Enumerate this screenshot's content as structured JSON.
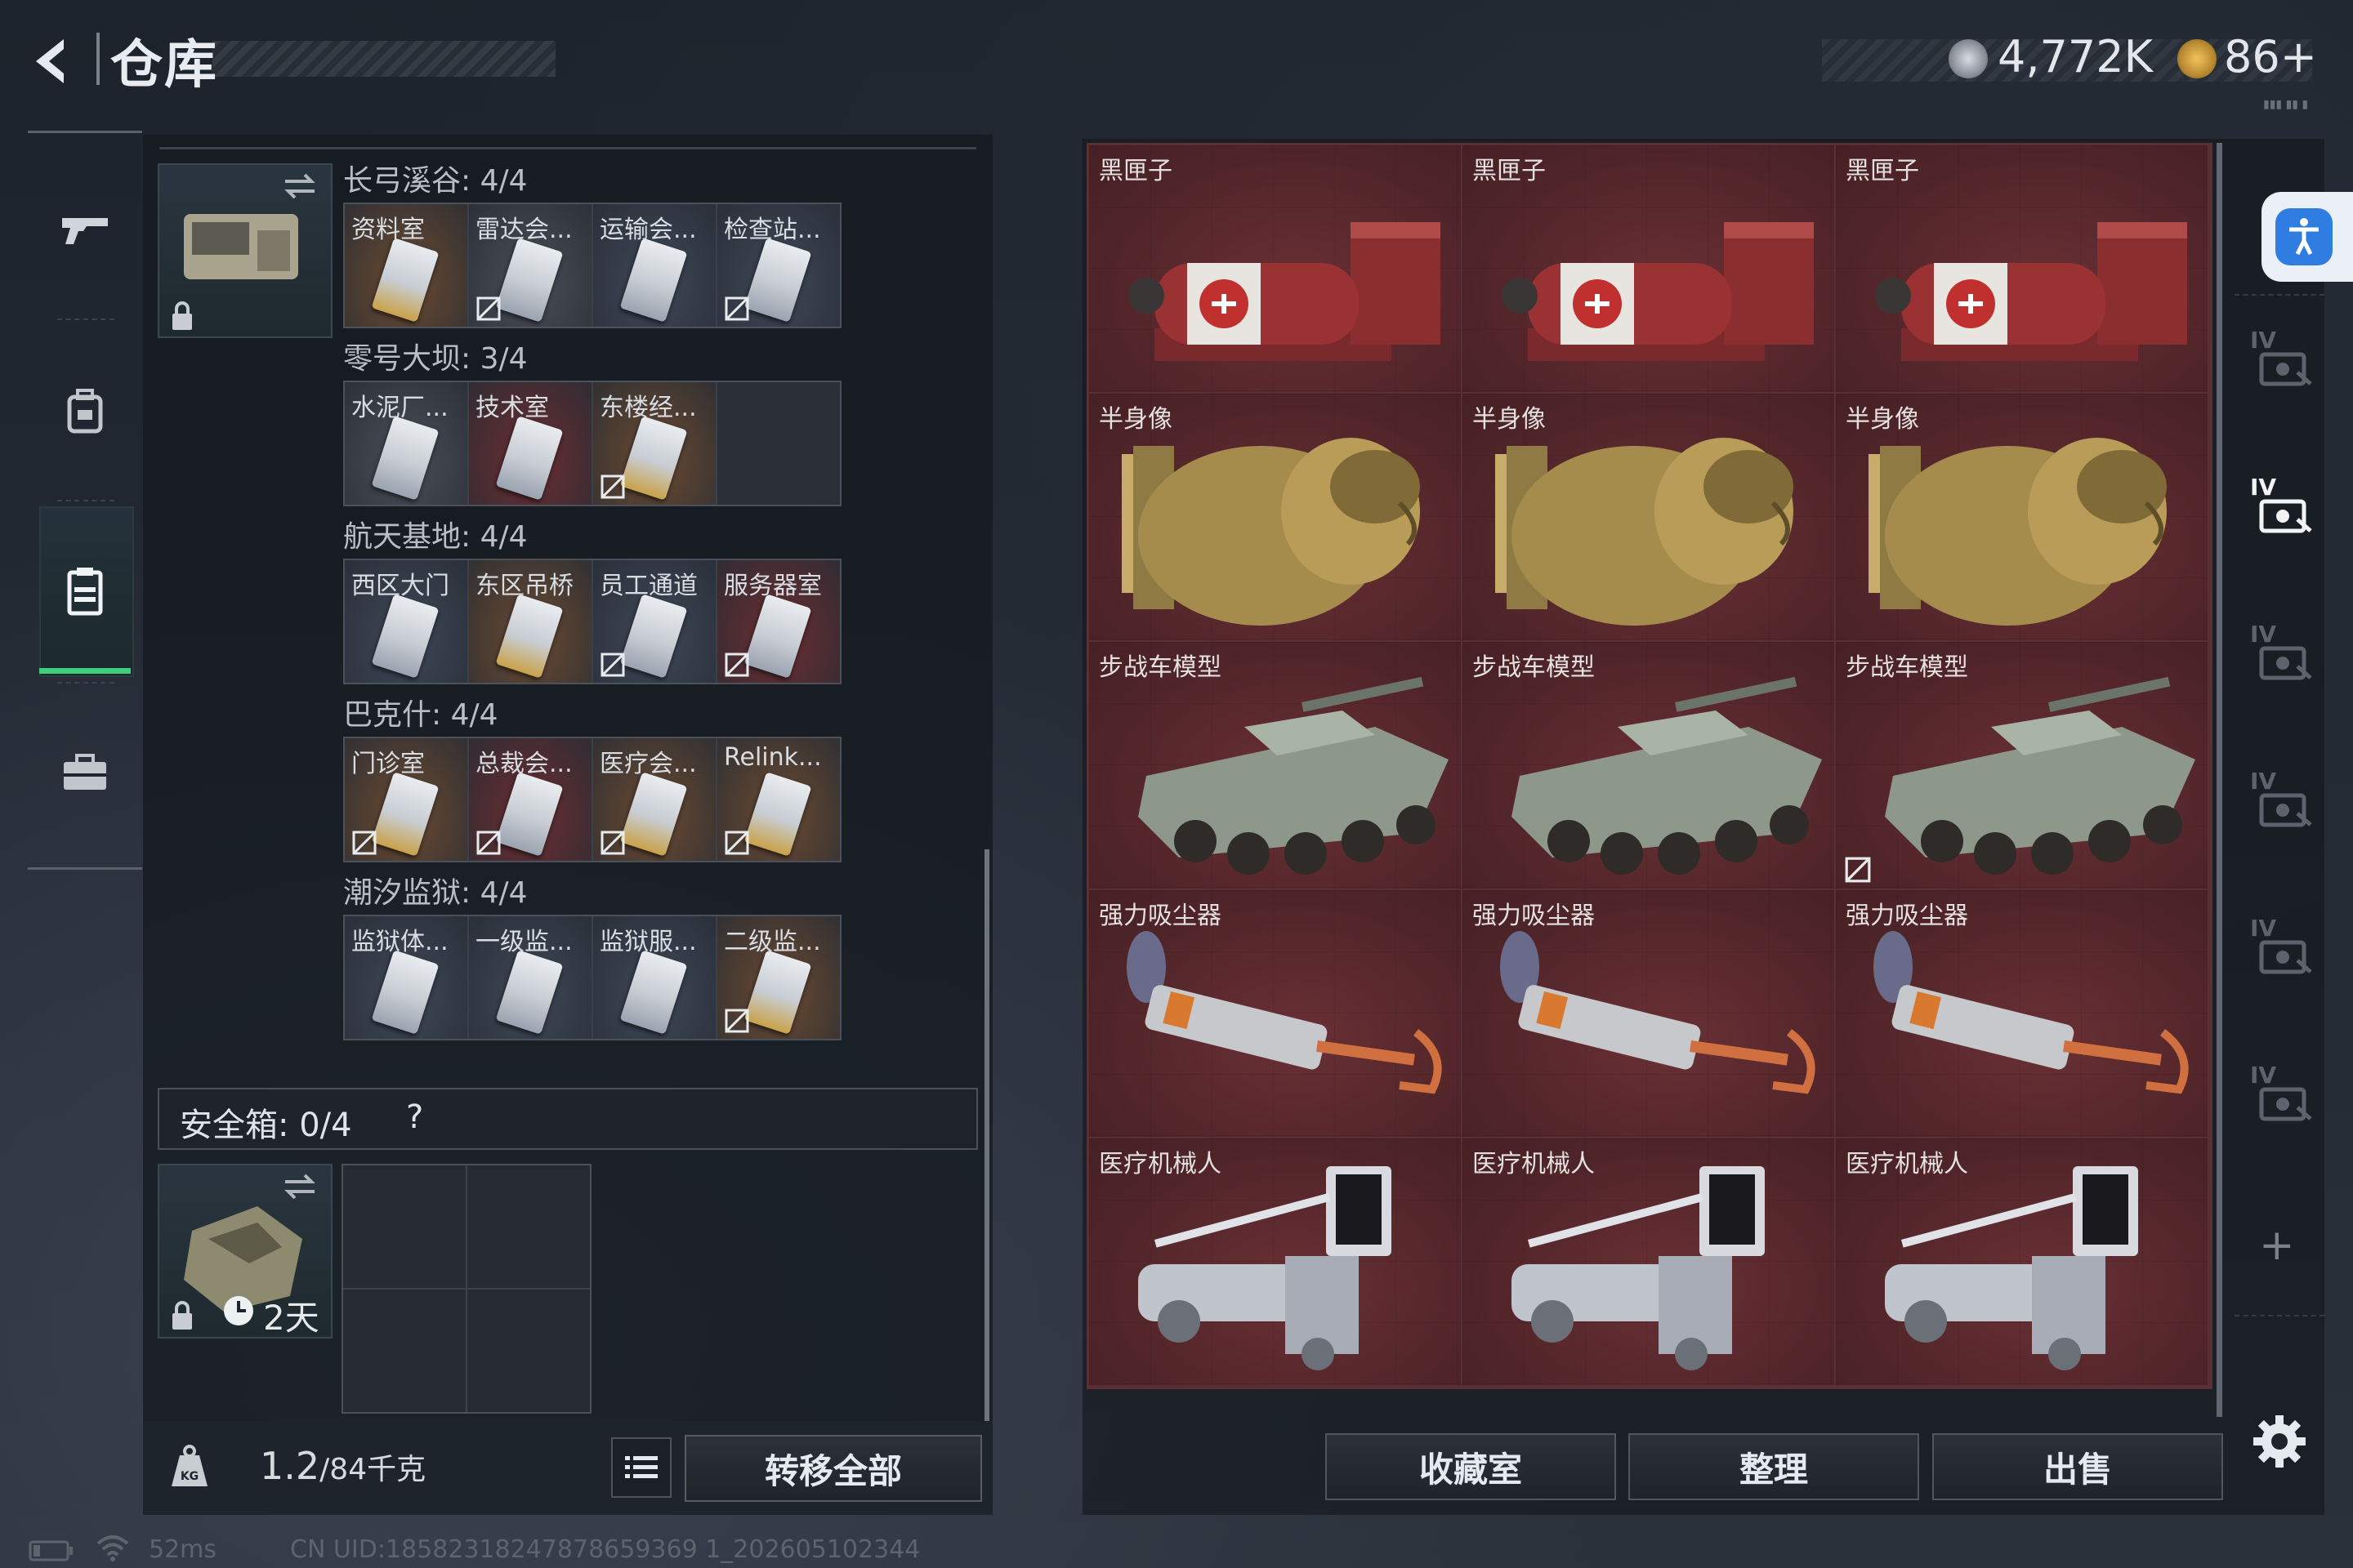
{
  "header": {
    "title": "仓库",
    "currency_coin": "4,772K",
    "currency_tri": "86+",
    "tiny_label": "▮▮▮ ▮▮ ▮"
  },
  "left": {
    "groups": [
      {
        "title": "长弓溪谷: 4/4",
        "cards": [
          {
            "label": "资料室",
            "color": "#6a4a32",
            "flag": false
          },
          {
            "label": "雷达会...",
            "color": "#4a4e58",
            "flag": true
          },
          {
            "label": "运输会...",
            "color": "#3e4858",
            "flag": false
          },
          {
            "label": "检查站...",
            "color": "#3e4858",
            "flag": true
          }
        ]
      },
      {
        "title": "零号大坝: 3/4",
        "cards": [
          {
            "label": "水泥厂...",
            "color": "#4a4e58",
            "flag": false
          },
          {
            "label": "技术室",
            "color": "#6a2e32",
            "flag": false
          },
          {
            "label": "东楼经...",
            "color": "#6a4a32",
            "flag": true
          },
          {
            "label": "",
            "color": "#2b3038",
            "flag": false,
            "empty": true
          }
        ]
      },
      {
        "title": "航天基地: 4/4",
        "cards": [
          {
            "label": "西区大门",
            "color": "#3e4858",
            "flag": false
          },
          {
            "label": "东区吊桥",
            "color": "#6a4a32",
            "flag": false
          },
          {
            "label": "员工通道",
            "color": "#3e4858",
            "flag": true
          },
          {
            "label": "服务器室",
            "color": "#6a2e32",
            "flag": true
          }
        ]
      },
      {
        "title": "巴克什: 4/4",
        "cards": [
          {
            "label": "门诊室",
            "color": "#6a4a32",
            "flag": true
          },
          {
            "label": "总裁会...",
            "color": "#6a2e32",
            "flag": true
          },
          {
            "label": "医疗会...",
            "color": "#6a4a32",
            "flag": true
          },
          {
            "label": "Relink...",
            "color": "#6a4a32",
            "flag": true
          }
        ]
      },
      {
        "title": "潮汐监狱: 4/4",
        "cards": [
          {
            "label": "监狱体...",
            "color": "#3e4858",
            "flag": false
          },
          {
            "label": "一级监...",
            "color": "#3e4858",
            "flag": false
          },
          {
            "label": "监狱服...",
            "color": "#3e4858",
            "flag": false
          },
          {
            "label": "二级监...",
            "color": "#6a4a32",
            "flag": true
          }
        ]
      }
    ],
    "safe_box": {
      "label": "安全箱: 0/4",
      "help": "?",
      "days": "2天"
    },
    "weight": {
      "current": "1.2",
      "max": "/84千克"
    },
    "transfer_all": "转移全部"
  },
  "items": [
    {
      "label": "黑匣子",
      "kind": "blackbox",
      "flag": false
    },
    {
      "label": "黑匣子",
      "kind": "blackbox",
      "flag": false
    },
    {
      "label": "黑匣子",
      "kind": "blackbox",
      "flag": false
    },
    {
      "label": "半身像",
      "kind": "bust",
      "flag": false
    },
    {
      "label": "半身像",
      "kind": "bust",
      "flag": false
    },
    {
      "label": "半身像",
      "kind": "bust",
      "flag": false
    },
    {
      "label": "步战车模型",
      "kind": "ifv",
      "flag": false
    },
    {
      "label": "步战车模型",
      "kind": "ifv",
      "flag": false
    },
    {
      "label": "步战车模型",
      "kind": "ifv",
      "flag": true
    },
    {
      "label": "强力吸尘器",
      "kind": "vacuum",
      "flag": false
    },
    {
      "label": "强力吸尘器",
      "kind": "vacuum",
      "flag": false
    },
    {
      "label": "强力吸尘器",
      "kind": "vacuum",
      "flag": false
    },
    {
      "label": "医疗机械人",
      "kind": "robot",
      "flag": false
    },
    {
      "label": "医疗机械人",
      "kind": "robot",
      "flag": false
    },
    {
      "label": "医疗机械人",
      "kind": "robot",
      "flag": false
    }
  ],
  "side_tabs": [
    "IV",
    "IV",
    "IV",
    "IV",
    "IV",
    "IV"
  ],
  "side_plus": "+",
  "buttons": {
    "collection": "收藏室",
    "sort": "整理",
    "sell": "出售"
  },
  "status": {
    "ping": "52ms",
    "uid": "CN UID:18582318247878659369 1_202605102344"
  },
  "colors": {
    "accent_green": "#3fcf7c",
    "item_bg": "#4e2428",
    "access_blue": "#2f7de1"
  }
}
